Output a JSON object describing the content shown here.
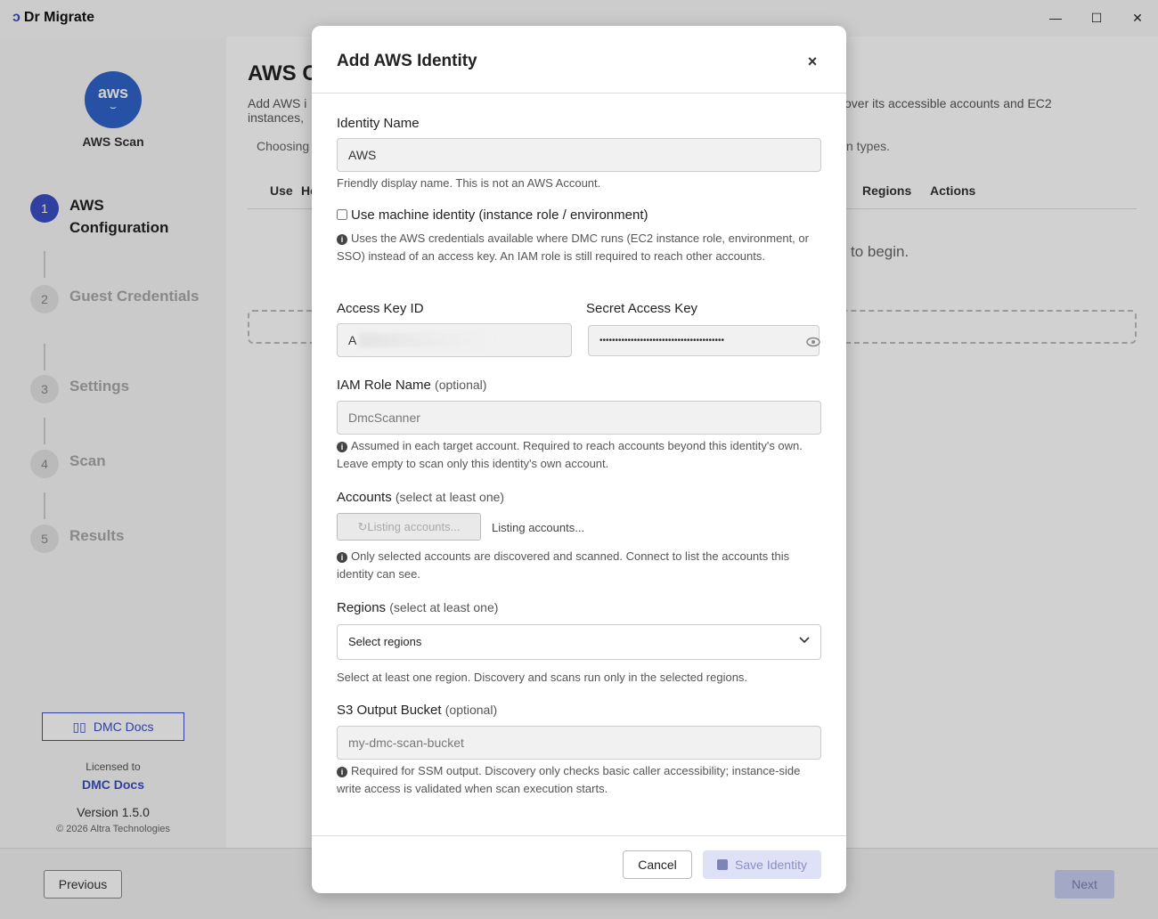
{
  "window": {
    "app_name": "Dr Migrate",
    "minimize": "—",
    "maximize": "☐",
    "close": "✕"
  },
  "sidebar": {
    "badge_text": "aws",
    "title": "AWS Scan",
    "steps": [
      {
        "num": "1",
        "label": "AWS Configuration"
      },
      {
        "num": "2",
        "label": "Guest Credentials"
      },
      {
        "num": "3",
        "label": "Settings"
      },
      {
        "num": "4",
        "label": "Scan"
      },
      {
        "num": "5",
        "label": "Results"
      }
    ],
    "docs_button": "DMC Docs",
    "licensed_to": "Licensed to",
    "licensee": "DMC Docs",
    "version": "Version 1.5.0",
    "copyright": "© 2026 Altra Technologies"
  },
  "main": {
    "title": "AWS C",
    "desc_left": "Add AWS i instances,",
    "desc_right": "over its accessible accounts and EC2",
    "note_left": "Choosing",
    "note_right": "n types.",
    "headers": [
      "Use",
      "He",
      "Regions",
      "Actions"
    ],
    "empty_text": "to begin."
  },
  "footer": {
    "previous": "Previous",
    "next": "Next"
  },
  "modal": {
    "title": "Add AWS Identity",
    "close": "×",
    "identity_name_label": "Identity Name",
    "identity_name_value": "AWS",
    "identity_name_help": "Friendly display name. This is not an AWS Account.",
    "machine_identity_label": "Use machine identity (instance role / environment)",
    "machine_identity_help": "Uses the AWS credentials available where DMC runs (EC2 instance role, environment, or SSO) instead of an access key. An IAM role is still required to reach other accounts.",
    "access_key_label": "Access Key ID",
    "access_key_value": "A",
    "secret_key_label": "Secret Access Key",
    "secret_key_mask": "••••••••••••••••••••••••••••••••••••••••",
    "iam_role_label": "IAM Role Name",
    "iam_role_optional": "(optional)",
    "iam_role_placeholder": "DmcScanner",
    "iam_role_help": "Assumed in each target account. Required to reach accounts beyond this identity's own. Leave empty to scan only this identity's own account.",
    "accounts_label": "Accounts",
    "accounts_qualifier": "(select at least one)",
    "accounts_button": "Listing accounts...",
    "accounts_status": "Listing accounts...",
    "accounts_help": "Only selected accounts are discovered and scanned. Connect to list the accounts this identity can see.",
    "regions_label": "Regions",
    "regions_qualifier": "(select at least one)",
    "regions_select": "Select regions",
    "regions_help": "Select at least one region. Discovery and scans run only in the selected regions.",
    "s3_label": "S3 Output Bucket",
    "s3_optional": "(optional)",
    "s3_placeholder": "my-dmc-scan-bucket",
    "s3_help": "Required for SSM output. Discovery only checks basic caller accessibility; instance-side write access is validated when scan execution starts.",
    "cancel": "Cancel",
    "save": "Save Identity"
  },
  "icons": {
    "info": "info-icon",
    "eye": "eye-icon",
    "chevron": "chevron-down-icon",
    "refresh": "refresh-icon",
    "save": "save-icon",
    "book": "book-icon"
  },
  "colors": {
    "accent": "#3b4fc4",
    "aws_badge": "#2f63c9"
  }
}
